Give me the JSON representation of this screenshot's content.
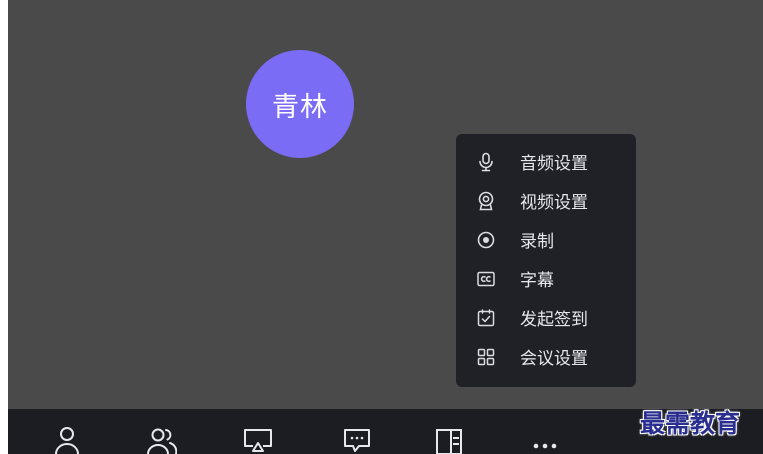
{
  "participant": {
    "display_name": "青林",
    "avatar_color": "#7b6cf6"
  },
  "more_menu": {
    "items": [
      {
        "label": "音频设置",
        "icon": "microphone-icon"
      },
      {
        "label": "视频设置",
        "icon": "webcam-icon"
      },
      {
        "label": "录制",
        "icon": "record-icon"
      },
      {
        "label": "字幕",
        "icon": "closed-caption-icon"
      },
      {
        "label": "发起签到",
        "icon": "check-in-icon"
      },
      {
        "label": "会议设置",
        "icon": "grid-settings-icon"
      }
    ]
  },
  "toolbar": {
    "buttons": [
      {
        "icon": "user-icon"
      },
      {
        "icon": "participants-icon"
      },
      {
        "icon": "share-screen-icon"
      },
      {
        "icon": "chat-icon"
      },
      {
        "icon": "side-panel-icon"
      },
      {
        "icon": "more-icon"
      }
    ]
  },
  "watermark": {
    "text": "最需教育",
    "color": "#2a2f8f"
  },
  "colors": {
    "stage_background": "#4a4a4a",
    "menu_background": "#1f2126",
    "toolbar_background": "#1b1d22",
    "menu_text": "#e6e8eb"
  }
}
